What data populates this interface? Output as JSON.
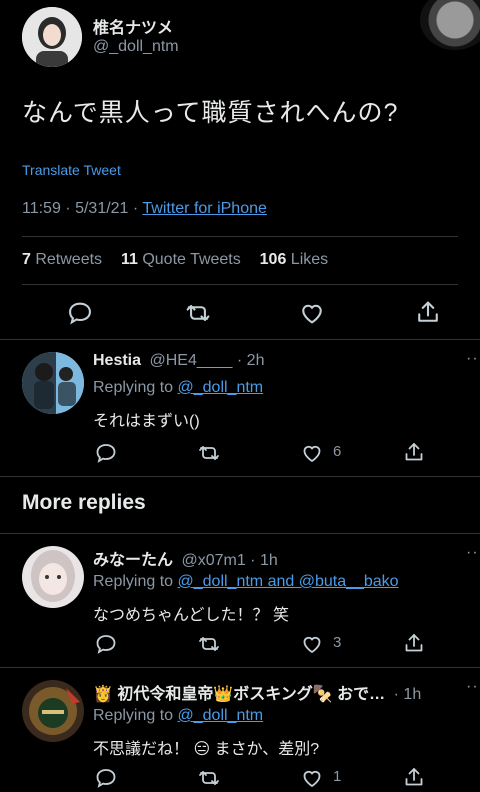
{
  "tweet": {
    "display_name": "椎名ナツメ",
    "handle": "@_doll_ntm",
    "text": "なんで黒人って職質されへんの?",
    "translate_label": "Translate Tweet",
    "timestamp": "11:59 · 5/31/21 · ",
    "client": "Twitter for iPhone",
    "retweets_count": "7",
    "retweets_label": " Retweets",
    "quote_count": "11",
    "quote_label": " Quote Tweets",
    "likes_count": "106",
    "likes_label": " Likes"
  },
  "replies": [
    {
      "display_name": "Hestia",
      "handle_time": "@HE4____ · 2h",
      "replying_prefix": "Replying to ",
      "replying_to": "@_doll_ntm",
      "text": "それはまずい()",
      "like_count": "6"
    }
  ],
  "more_replies_heading": "More replies",
  "more_replies": [
    {
      "display_name": "みなーたん",
      "handle_time": "@x07m1 · 1h",
      "replying_prefix": "Replying to ",
      "replying_to": "@_doll_ntm and @buta__bako",
      "text": "なつめちゃんどした！？ 笑",
      "like_count": "3"
    },
    {
      "display_name": "👸 初代令和皇帝👑ボスキング🍢 おで…",
      "handle_time": "· 1h",
      "replying_prefix": "Replying to ",
      "replying_to": "@_doll_ntm",
      "text": "不思議だね！ 😑 まさか、差別?",
      "like_count": "1"
    }
  ],
  "colors": {
    "background": "#000000",
    "link": "#4a9be8",
    "muted": "#8b98a5",
    "divider": "#2f3336"
  }
}
